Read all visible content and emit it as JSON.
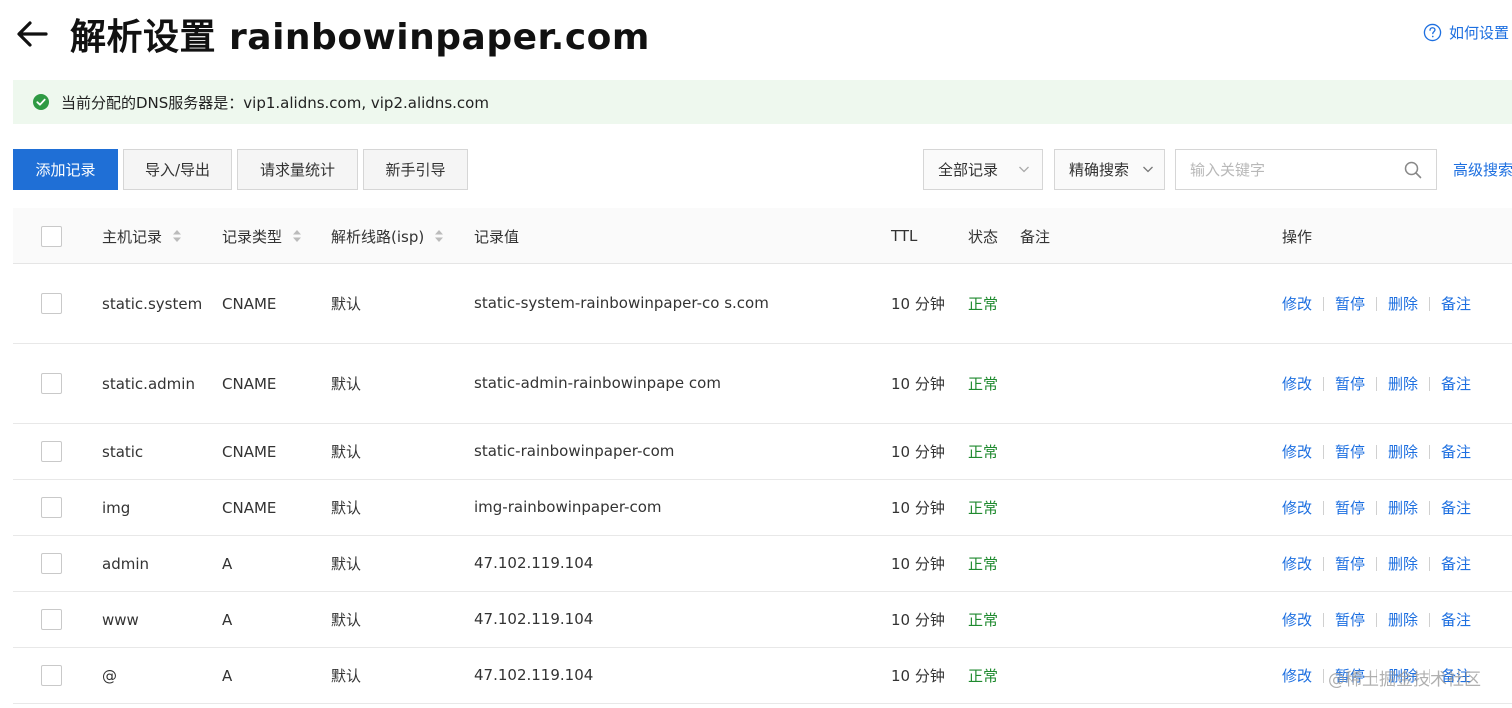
{
  "header": {
    "title": "解析设置 rainbowinpaper.com",
    "help_label": "如何设置"
  },
  "notice": {
    "text": "当前分配的DNS服务器是：vip1.alidns.com, vip2.alidns.com"
  },
  "toolbar": {
    "add_record": "添加记录",
    "import_export": "导入/导出",
    "request_stats": "请求量统计",
    "guide": "新手引导",
    "filter_all": "全部记录",
    "exact_search": "精确搜索",
    "search_placeholder": "输入关键字",
    "advanced_search": "高级搜索"
  },
  "table": {
    "headers": {
      "host": "主机记录",
      "type": "记录类型",
      "line": "解析线路(isp)",
      "value": "记录值",
      "ttl": "TTL",
      "status": "状态",
      "remark": "备注",
      "ops": "操作"
    },
    "ops": {
      "edit": "修改",
      "pause": "暂停",
      "delete": "删除",
      "remark": "备注"
    },
    "rows": [
      {
        "host": "static.system",
        "type": "CNAME",
        "line": "默认",
        "value": "static-system-rainbowinpaper-co s.com",
        "ttl": "10 分钟",
        "status": "正常"
      },
      {
        "host": "static.admin",
        "type": "CNAME",
        "line": "默认",
        "value": "static-admin-rainbowinpape com",
        "ttl": "10 分钟",
        "status": "正常"
      },
      {
        "host": "static",
        "type": "CNAME",
        "line": "默认",
        "value": "static-rainbowinpaper-com",
        "ttl": "10 分钟",
        "status": "正常"
      },
      {
        "host": "img",
        "type": "CNAME",
        "line": "默认",
        "value": "img-rainbowinpaper-com",
        "ttl": "10 分钟",
        "status": "正常"
      },
      {
        "host": "admin",
        "type": "A",
        "line": "默认",
        "value": "47.102.119.104",
        "ttl": "10 分钟",
        "status": "正常"
      },
      {
        "host": "www",
        "type": "A",
        "line": "默认",
        "value": "47.102.119.104",
        "ttl": "10 分钟",
        "status": "正常"
      },
      {
        "host": "@",
        "type": "A",
        "line": "默认",
        "value": "47.102.119.104",
        "ttl": "10 分钟",
        "status": "正常"
      }
    ]
  },
  "watermark": "@稀土掘金技术社区",
  "colors": {
    "primary": "#1f6fd6",
    "link": "#1d6fe0",
    "success": "#1f8a2f",
    "notice_bg": "#eef8ee"
  }
}
